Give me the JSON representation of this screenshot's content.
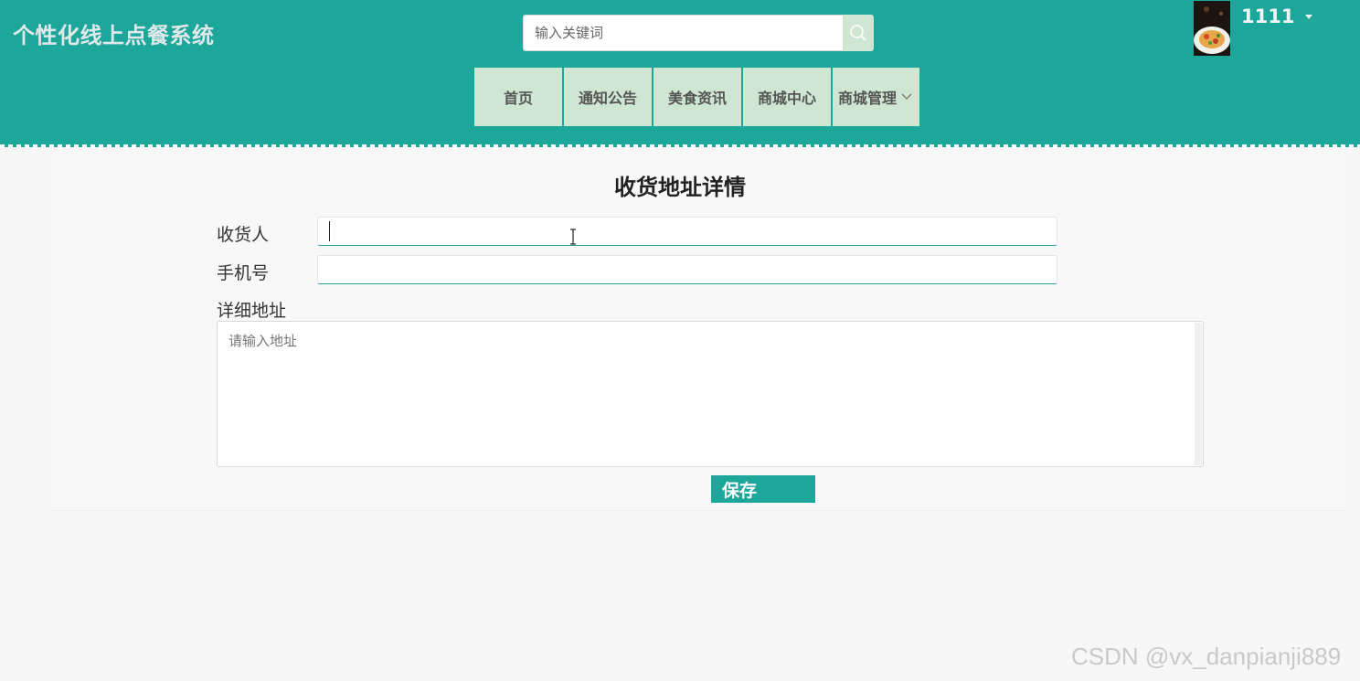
{
  "header": {
    "site_title": "个性化线上点餐系统",
    "search_placeholder": "输入关键词",
    "username": "1111",
    "accent_color": "#1da69a",
    "icons": {
      "search": "search-icon",
      "user_menu": "caret-down-icon"
    }
  },
  "nav": {
    "items": [
      {
        "label": "首页"
      },
      {
        "label": "通知公告"
      },
      {
        "label": "美食资讯"
      },
      {
        "label": "商城中心"
      },
      {
        "label": "商城管理",
        "icon": "chevron-down-icon"
      }
    ]
  },
  "form": {
    "title": "收货地址详情",
    "receiver_label": "收货人",
    "receiver_value": "",
    "phone_label": "手机号",
    "phone_value": "",
    "address_label": "详细地址",
    "address_placeholder": "请输入地址",
    "save_label": "保存"
  },
  "watermark": "CSDN @vx_danpianji889"
}
